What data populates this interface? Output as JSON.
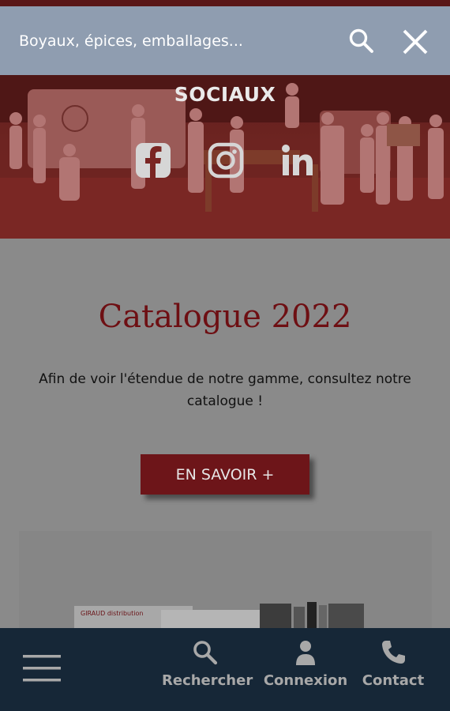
{
  "search": {
    "query": "Boyaux, épices, emballages..."
  },
  "hero": {
    "title": "SOCIAUX",
    "social": [
      "facebook-icon",
      "instagram-icon",
      "linkedin-icon"
    ]
  },
  "catalogue": {
    "title": "Catalogue 2022",
    "description": "Afin de voir l'étendue de notre gamme, consultez notre catalogue !",
    "button_label": "EN SAVOIR +",
    "cover_text": "GIRAUD distribution"
  },
  "bottom_nav": {
    "items": [
      {
        "label": "Rechercher",
        "icon": "search-icon"
      },
      {
        "label": "Connexion",
        "icon": "user-icon"
      },
      {
        "label": "Contact",
        "icon": "phone-icon"
      }
    ]
  },
  "colors": {
    "brand_red": "#6d1519",
    "search_bar": "#8f9db0",
    "nav_bg": "#162737"
  }
}
